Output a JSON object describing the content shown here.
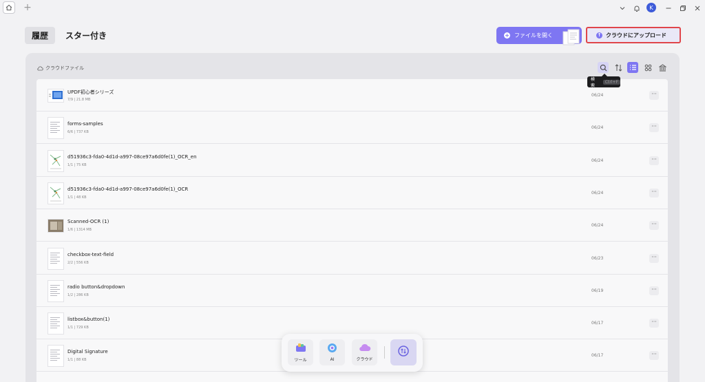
{
  "titlebar": {
    "avatar_letter": "K",
    "icons": [
      "home-icon",
      "new-tab-icon",
      "chevron-down-icon",
      "notification-icon",
      "minimize-icon",
      "restore-icon",
      "close-icon"
    ]
  },
  "header": {
    "tabs": [
      {
        "label": "履歴",
        "active": true
      },
      {
        "label": "スター付き",
        "active": false
      }
    ],
    "open_file_label": "ファイルを開く",
    "upload_label": "クラウドにアップロード"
  },
  "toolbar": {
    "cloud_files_label": "クラウドファイル",
    "tooltip_label": "検索",
    "tooltip_shortcut": "Ctrl+F",
    "icons": [
      "search-icon",
      "sort-icon",
      "list-view-icon",
      "grid-view-icon",
      "bank-icon"
    ]
  },
  "files": [
    {
      "name": "UPDF初心者シリーズ",
      "meta": "7/9 | 21.8 MB",
      "date": "06/24",
      "thumb": "wide-blue"
    },
    {
      "name": "forms-samples",
      "meta": "6/6 | 737 KB",
      "date": "06/24",
      "thumb": "doc"
    },
    {
      "name": "d51936c3-fda0-4d1d-a997-08ce97a6d0fe(1)_OCR_en",
      "meta": "1/1 | 75 KB",
      "date": "06/24",
      "thumb": "map"
    },
    {
      "name": "d51936c3-fda0-4d1d-a997-08ce97a6d0fe(1)_OCR",
      "meta": "1/1 | 48 KB",
      "date": "06/24",
      "thumb": "map"
    },
    {
      "name": "Scanned-OCR (1)",
      "meta": "1/6 | 1314 MB",
      "date": "06/24",
      "thumb": "wide-photo"
    },
    {
      "name": "checkbox-text-field",
      "meta": "2/2 | 556 KB",
      "date": "06/23",
      "thumb": "doc"
    },
    {
      "name": "radio button&dropdown",
      "meta": "1/2 | 286 KB",
      "date": "06/19",
      "thumb": "doc"
    },
    {
      "name": "listbox&button(1)",
      "meta": "1/1 | 729 KB",
      "date": "06/17",
      "thumb": "doc"
    },
    {
      "name": "Digital Signature",
      "meta": "1/1 | 88 KB",
      "date": "06/17",
      "thumb": "doc"
    }
  ],
  "dock": {
    "items": [
      {
        "label": "ツール",
        "icon": "tools-icon"
      },
      {
        "label": "AI",
        "icon": "ai-icon"
      },
      {
        "label": "クラウド",
        "icon": "cloud-icon"
      }
    ],
    "history_icon": "history-icon"
  },
  "colors": {
    "accent": "#7e76f2",
    "highlight_border": "#e0454a"
  }
}
